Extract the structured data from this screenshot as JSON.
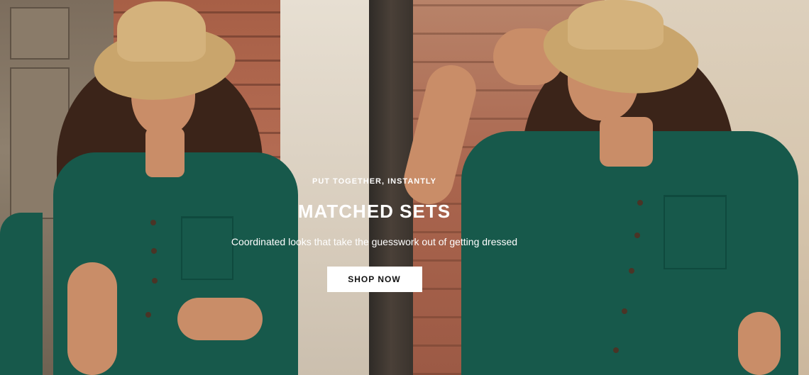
{
  "hero": {
    "eyebrow": "PUT TOGETHER, INSTANTLY",
    "headline": "MATCHED SETS",
    "subtext": "Coordinated looks that take the guesswork out of getting dressed",
    "cta_label": "SHOP NOW"
  },
  "colors": {
    "shirt": "#17594b",
    "cta_background": "#ffffff",
    "cta_text": "#111111",
    "overlay_text": "#ffffff"
  }
}
